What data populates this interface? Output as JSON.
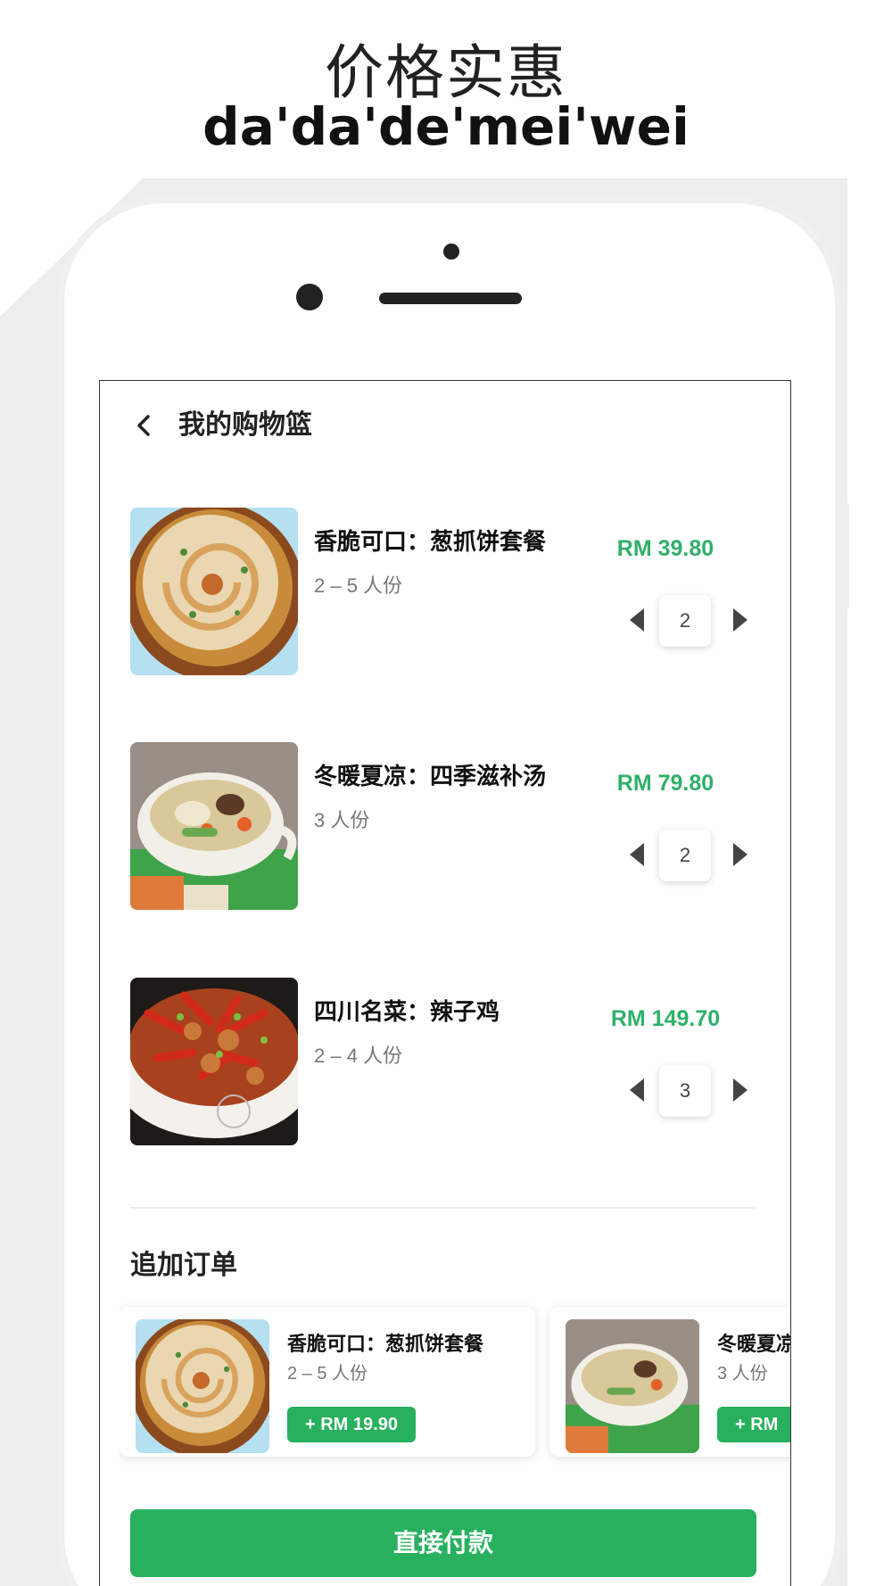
{
  "header": {
    "title_cn": "价格实惠",
    "title_en": "da'da'de'mei'wei"
  },
  "app": {
    "title": "我的购物篮",
    "back_icon": "chevron-left-icon"
  },
  "cart": {
    "items": [
      {
        "name": "香脆可口：葱抓饼套餐",
        "serves": "2 – 5 人份",
        "price": "RM 39.80",
        "qty": "2",
        "image": "scallion-pancake"
      },
      {
        "name": "冬暖夏凉：四季滋补汤",
        "serves": "3 人份",
        "price": "RM 79.80",
        "qty": "2",
        "image": "soup-bowl"
      },
      {
        "name": "四川名菜：辣子鸡",
        "serves": "2 – 4 人份",
        "price": "RM 149.70",
        "qty": "3",
        "image": "spicy-chicken"
      }
    ]
  },
  "addons": {
    "title": "追加订单",
    "items": [
      {
        "name": "香脆可口：葱抓饼套餐",
        "serves": "2 – 5 人份",
        "button": "+ RM 19.90",
        "image": "scallion-pancake"
      },
      {
        "name": "冬暖夏凉：四季滋补汤",
        "serves": "3 人份",
        "button": "+ RM",
        "image": "soup-bowl"
      }
    ]
  },
  "pay_button": "直接付款",
  "colors": {
    "accent": "#27b05e",
    "price": "#2fb06a"
  }
}
